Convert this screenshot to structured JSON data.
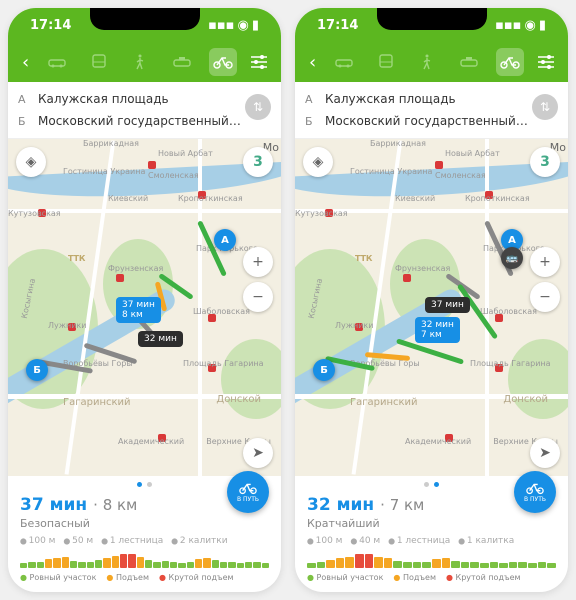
{
  "status": {
    "time": "17:14"
  },
  "search": {
    "labelA": "А",
    "labelB": "Б",
    "pointA": "Калужская площадь",
    "pointB": "Московский государственный…"
  },
  "map": {
    "labels": {
      "arbat": "Новый Арбат",
      "barrikadnaya": "Баррикадная",
      "ukraina": "Гостиница Украина",
      "kutuzov": "Кутузовская",
      "kievsky": "Киевский",
      "smolensky": "Смоленская",
      "kropotkin": "Кропоткинская",
      "mo": "Мо",
      "frunze": "Фрунзенская",
      "luzhniki": "Лужники",
      "gorky": "Парк Горького",
      "shabolov": "Шаболовская",
      "vorobyovy": "Воробьёвы Горы",
      "gagarin": "Площадь Гагарина",
      "gagarinsky": "Гагаринский",
      "donskoy": "Донской",
      "akadem": "Академический",
      "kotly": "Верхние Котлы",
      "kt": "Косыгина",
      "ttk": "ТТК"
    },
    "traffic_score": "3"
  },
  "go_label": "В ПУТЬ",
  "legend": {
    "flat": "Ровный участок",
    "up": "Подъем",
    "steep": "Крутой подъем"
  },
  "screens": [
    {
      "tips": {
        "primary_time": "37 мин",
        "primary_dist": "8 км",
        "secondary": "32 мин"
      },
      "dots_active": 0,
      "summary": {
        "time": "37 мин",
        "dist": "8 км",
        "subtitle": "Безопасный"
      },
      "stats": {
        "elev_up": "100 м",
        "elev_down": "50 м",
        "stairs": "1 лестница",
        "gates": "2 калитки"
      }
    },
    {
      "tips": {
        "secondary": "37 мин",
        "primary_time": "32 мин",
        "primary_dist": "7 км"
      },
      "dots_active": 1,
      "summary": {
        "time": "32 мин",
        "dist": "7 км",
        "subtitle": "Кратчайший"
      },
      "stats": {
        "elev_up": "100 м",
        "elev_down": "40 м",
        "stairs": "1 лестница",
        "gates": "1 калитка"
      }
    }
  ]
}
